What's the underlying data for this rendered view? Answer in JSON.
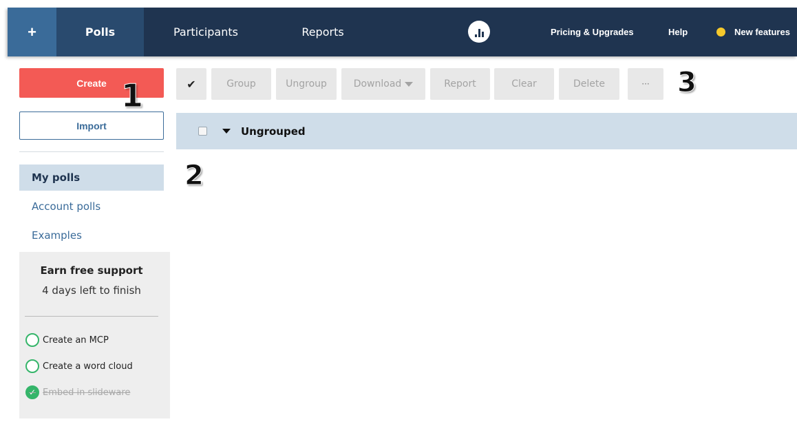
{
  "topbar": {
    "plus_label": "+",
    "tabs": [
      {
        "label": "Polls",
        "active": true
      },
      {
        "label": "Participants",
        "active": false
      },
      {
        "label": "Reports",
        "active": false
      }
    ],
    "logo_icon": "poll-everywhere-logo-icon",
    "links": {
      "pricing": "Pricing & Upgrades",
      "help": "Help",
      "new_features": "New features"
    },
    "new_features_dot_color": "#f6c92b",
    "bg_color": "#1f3450"
  },
  "sidebar": {
    "create_label": "Create",
    "import_label": "Import",
    "nav": [
      {
        "label": "My polls",
        "active": true
      },
      {
        "label": "Account polls",
        "active": false
      },
      {
        "label": "Examples",
        "active": false
      }
    ],
    "earn": {
      "title": "Earn free support",
      "subtitle": "4 days left to finish",
      "tasks": [
        {
          "label": "Create an MCP",
          "done": false
        },
        {
          "label": "Create a word cloud",
          "done": false
        },
        {
          "label": "Embed in slideware",
          "done": true
        }
      ]
    }
  },
  "toolbar": {
    "check_icon": "checkmark-icon",
    "group": "Group",
    "ungroup": "Ungroup",
    "download": "Download",
    "report": "Report",
    "clear": "Clear",
    "delete": "Delete",
    "more": "···"
  },
  "group_row": {
    "name": "Ungrouped"
  },
  "annotations": [
    "1",
    "2",
    "3"
  ],
  "colors": {
    "create": "#f35a55",
    "accent": "#3a6b99",
    "selected": "#cfdde9",
    "task_green": "#35b56a"
  }
}
